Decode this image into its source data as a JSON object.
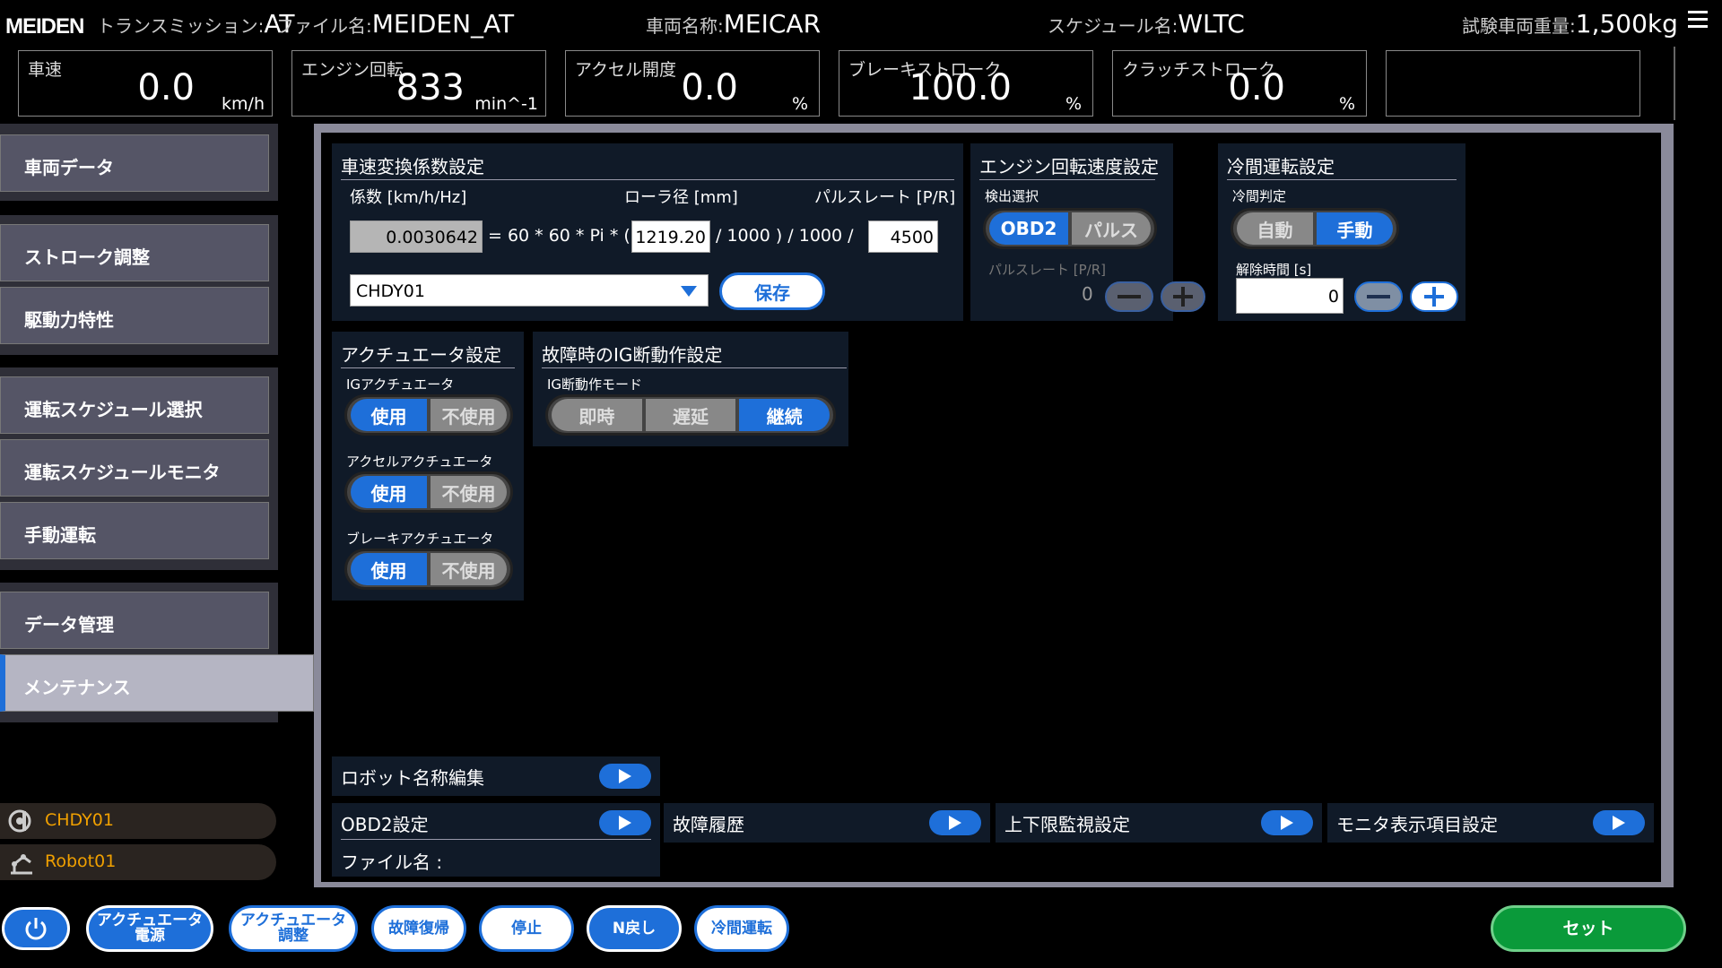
{
  "header": {
    "logo": "MEIDEN",
    "transmission_label": "トランスミッション:",
    "transmission_value": "AT",
    "file_label": "ファイル名:",
    "file_value": "MEIDEN_AT",
    "vehicle_label": "車両名称:",
    "vehicle_value": "MEICAR",
    "schedule_label": "スケジュール名:",
    "schedule_value": "WLTC",
    "weight_label": "試験車両重量:",
    "weight_value": "1,500kg"
  },
  "meters": [
    {
      "label": "車速",
      "value": "0.0",
      "unit": "km/h"
    },
    {
      "label": "エンジン回転",
      "value": "833",
      "unit": "min^-1"
    },
    {
      "label": "アクセル開度",
      "value": "0.0",
      "unit": "%"
    },
    {
      "label": "ブレーキストローク",
      "value": "100.0",
      "unit": "%"
    },
    {
      "label": "クラッチストローク",
      "value": "0.0",
      "unit": "%"
    }
  ],
  "sidebar": {
    "items": [
      "車両データ",
      "ストローク調整",
      "駆動力特性",
      "運転スケジュール選択",
      "運転スケジュールモニタ",
      "手動運転",
      "データ管理",
      "メンテナンス"
    ],
    "active": "メンテナンス",
    "status": [
      "CHDY01",
      "Robot01"
    ]
  },
  "speed_coef": {
    "title": "車速変換係数設定",
    "col1": "係数 [km/h/Hz]",
    "col2": "ローラ径 [mm]",
    "col3": "パルスレート [P/R]",
    "coef_value": "0.0030642",
    "formula1": "= 60 * 60 * Pi * (",
    "roller_value": "1219.20",
    "formula2": "/ 1000 ) / 1000 /",
    "pulse_value": "4500",
    "select_value": "CHDY01",
    "save_label": "保存"
  },
  "engine_speed": {
    "title": "エンジン回転速度設定",
    "detect_label": "検出選択",
    "options": [
      "OBD2",
      "パルス"
    ],
    "selected": "OBD2",
    "pulse_label": "パルスレート [P/R]",
    "pulse_value": "0"
  },
  "cold": {
    "title": "冷間運転設定",
    "judge_label": "冷間判定",
    "options": [
      "自動",
      "手動"
    ],
    "selected": "手動",
    "release_label": "解除時間 [s]",
    "release_value": "0"
  },
  "actuator": {
    "title": "アクチュエータ設定",
    "rows": [
      {
        "label": "IGアクチュエータ",
        "on": "使用",
        "off": "不使用"
      },
      {
        "label": "アクセルアクチュエータ",
        "on": "使用",
        "off": "不使用"
      },
      {
        "label": "ブレーキアクチュエータ",
        "on": "使用",
        "off": "不使用"
      }
    ]
  },
  "ig_fault": {
    "title": "故障時のIG断動作設定",
    "mode_label": "IG断動作モード",
    "options": [
      "即時",
      "遅延",
      "継続"
    ],
    "selected": "継続"
  },
  "links": {
    "robot_name": "ロボット名称編集",
    "obd2": "OBD2設定",
    "obd2_file": "ファイル名 :",
    "fault_history": "故障履歴",
    "limit_monitor": "上下限監視設定",
    "monitor_items": "モニタ表示項目設定"
  },
  "bottom": {
    "actuator_power": "アクチュエータ\n電源",
    "actuator_adjust": "アクチュエータ\n調整",
    "fault_reset": "故障復帰",
    "stop": "停止",
    "n_return": "N戻し",
    "cold_run": "冷間運転",
    "set": "セット"
  },
  "colors": {
    "accent": "#1e6fd9",
    "set_button": "#0a9a3a",
    "status_text": "#f0a000"
  }
}
